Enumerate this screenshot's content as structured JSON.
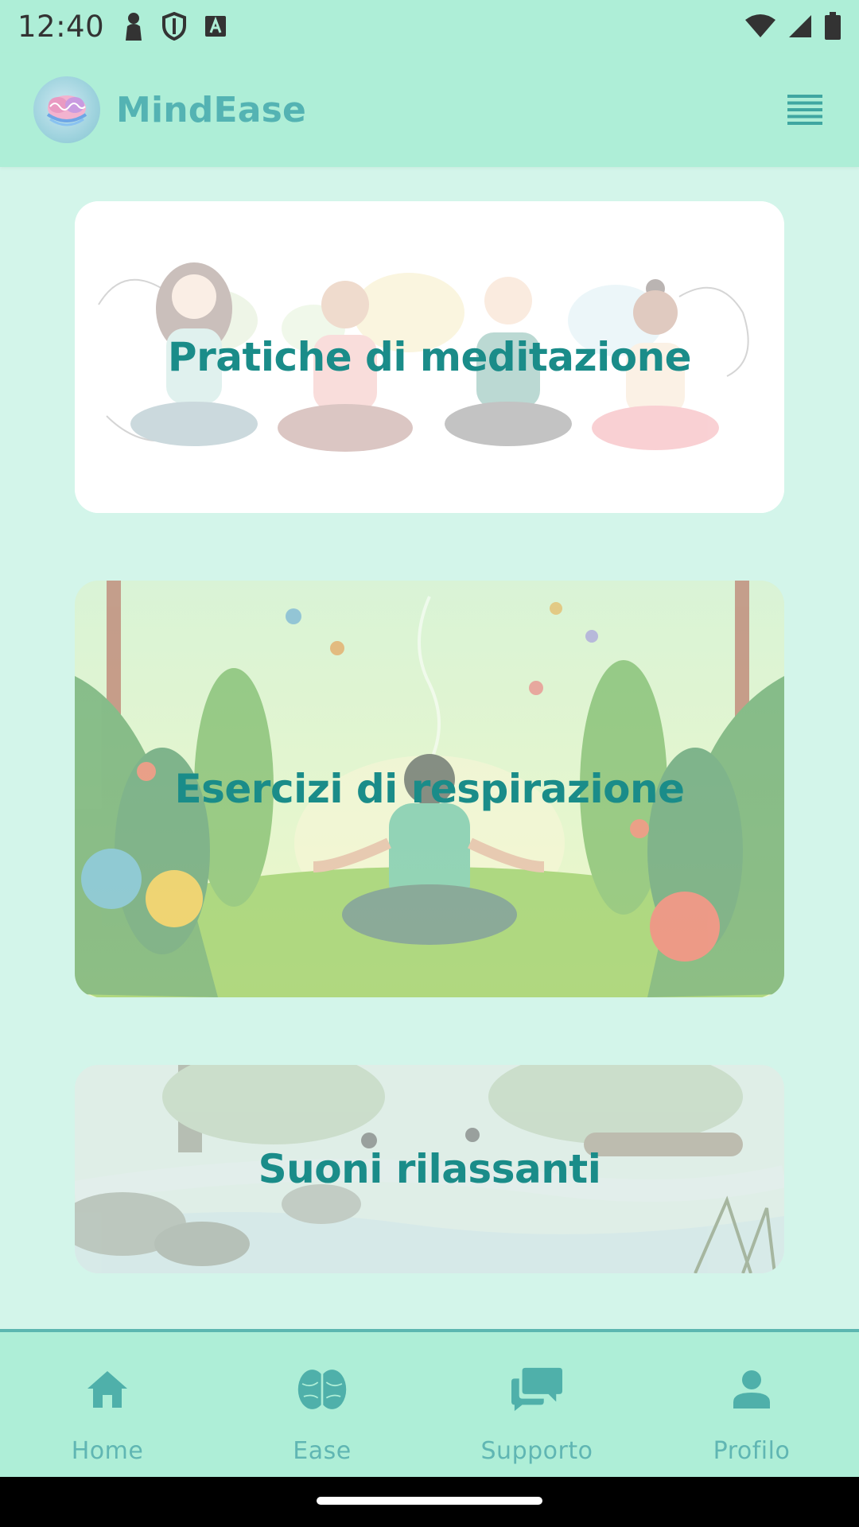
{
  "status_bar": {
    "time": "12:40",
    "icons_left": [
      "person-icon",
      "shield-icon",
      "keyboard-a-icon"
    ],
    "icons_right": [
      "wifi-icon",
      "signal-icon",
      "battery-icon"
    ]
  },
  "app_bar": {
    "title": "MindEase",
    "logo_icon": "brain-logo-icon",
    "menu_icon": "menu-icon"
  },
  "cards": [
    {
      "title": "Pratiche di meditazione"
    },
    {
      "title": "Esercizi di respirazione"
    },
    {
      "title": "Suoni rilassanti"
    }
  ],
  "bottom_nav": {
    "items": [
      {
        "label": "Home",
        "icon": "home-icon"
      },
      {
        "label": "Ease",
        "icon": "brain-icon"
      },
      {
        "label": "Supporto",
        "icon": "chat-icon"
      },
      {
        "label": "Profilo",
        "icon": "person-icon"
      }
    ]
  },
  "colors": {
    "background": "#d3f5ea",
    "bar": "#aeeed7",
    "accent": "#1a8c89",
    "nav_icon": "#4fb0aa"
  }
}
